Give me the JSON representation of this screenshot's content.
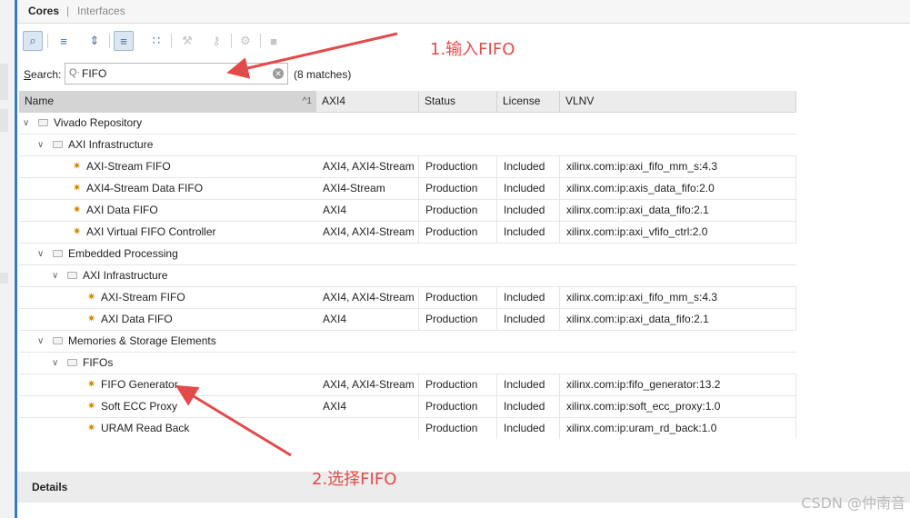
{
  "tabs": {
    "cores": "Cores",
    "separator": "|",
    "interfaces": "Interfaces"
  },
  "toolbar": {
    "items": [
      {
        "name": "search-icon",
        "glyph": "⌕",
        "state": "active"
      },
      {
        "name": "collapse-all-icon",
        "glyph": "≡",
        "state": "normal"
      },
      {
        "name": "expand-all-icon",
        "glyph": "⇕",
        "state": "normal"
      },
      {
        "name": "hierarchy-icon",
        "glyph": "≡",
        "state": "active"
      },
      {
        "name": "tree-view-icon",
        "glyph": "∷",
        "state": "normal"
      },
      {
        "name": "wrench-icon",
        "glyph": "⚒",
        "state": "disabled"
      },
      {
        "name": "key-icon",
        "glyph": "⚷",
        "state": "disabled"
      },
      {
        "name": "gear-icon",
        "glyph": "⚙",
        "state": "disabled"
      },
      {
        "name": "stop-icon",
        "glyph": "■",
        "state": "disabled"
      }
    ]
  },
  "search": {
    "label_underlined": "S",
    "label_rest": "earch:",
    "value": "FIFO",
    "placeholder": "",
    "matches": "(8 matches)"
  },
  "table": {
    "headers": {
      "name": "Name",
      "sort": "^1",
      "axi": "AXI4",
      "status": "Status",
      "license": "License",
      "vlnv": "VLNV"
    },
    "rows": [
      {
        "level": 0,
        "type": "folder",
        "name": "Vivado Repository"
      },
      {
        "level": 1,
        "type": "folder",
        "name": "AXI Infrastructure"
      },
      {
        "level": 2,
        "type": "core",
        "name": "AXI-Stream FIFO",
        "axi": "AXI4, AXI4-Stream",
        "status": "Production",
        "license": "Included",
        "vlnv": "xilinx.com:ip:axi_fifo_mm_s:4.3"
      },
      {
        "level": 2,
        "type": "core",
        "name": "AXI4-Stream Data FIFO",
        "axi": "AXI4-Stream",
        "status": "Production",
        "license": "Included",
        "vlnv": "xilinx.com:ip:axis_data_fifo:2.0"
      },
      {
        "level": 2,
        "type": "core",
        "name": "AXI Data FIFO",
        "axi": "AXI4",
        "status": "Production",
        "license": "Included",
        "vlnv": "xilinx.com:ip:axi_data_fifo:2.1"
      },
      {
        "level": 2,
        "type": "core",
        "name": "AXI Virtual FIFO Controller",
        "axi": "AXI4, AXI4-Stream",
        "status": "Production",
        "license": "Included",
        "vlnv": "xilinx.com:ip:axi_vfifo_ctrl:2.0"
      },
      {
        "level": 1,
        "type": "folder",
        "name": "Embedded Processing"
      },
      {
        "level": 2,
        "type": "folder",
        "name": "AXI Infrastructure"
      },
      {
        "level": 3,
        "type": "core",
        "name": "AXI-Stream FIFO",
        "axi": "AXI4, AXI4-Stream",
        "status": "Production",
        "license": "Included",
        "vlnv": "xilinx.com:ip:axi_fifo_mm_s:4.3"
      },
      {
        "level": 3,
        "type": "core",
        "name": "AXI Data FIFO",
        "axi": "AXI4",
        "status": "Production",
        "license": "Included",
        "vlnv": "xilinx.com:ip:axi_data_fifo:2.1"
      },
      {
        "level": 1,
        "type": "folder",
        "name": "Memories & Storage Elements"
      },
      {
        "level": 2,
        "type": "folder",
        "name": "FIFOs"
      },
      {
        "level": 3,
        "type": "core",
        "name": "FIFO Generator",
        "axi": "AXI4, AXI4-Stream",
        "status": "Production",
        "license": "Included",
        "vlnv": "xilinx.com:ip:fifo_generator:13.2"
      },
      {
        "level": 3,
        "type": "core",
        "name": "Soft ECC Proxy",
        "axi": "AXI4",
        "status": "Production",
        "license": "Included",
        "vlnv": "xilinx.com:ip:soft_ecc_proxy:1.0"
      },
      {
        "level": 3,
        "type": "core",
        "name": "URAM Read Back",
        "axi": "",
        "status": "Production",
        "license": "Included",
        "vlnv": "xilinx.com:ip:uram_rd_back:1.0"
      }
    ]
  },
  "details": {
    "title": "Details"
  },
  "annotations": {
    "step1": "1.输入FIFO",
    "step2": "2.选择FIFO",
    "color": "#e34b4b"
  },
  "watermark": "CSDN @仲南音"
}
